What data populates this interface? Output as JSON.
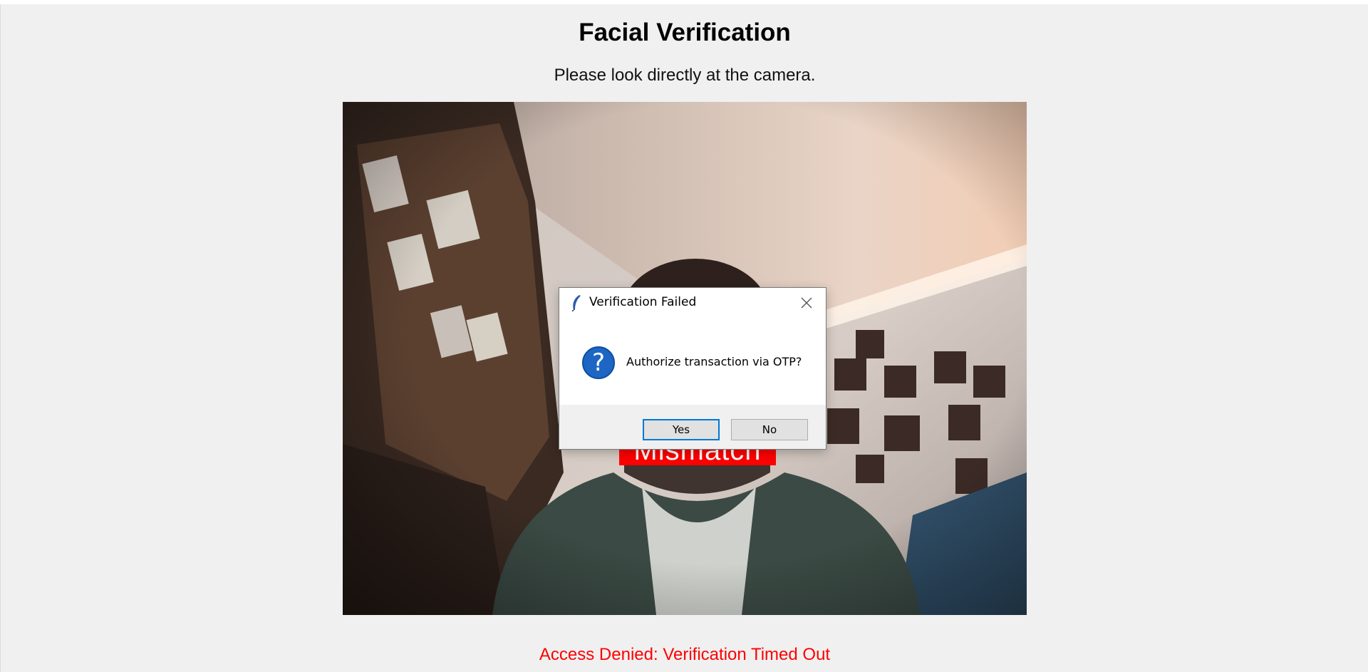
{
  "page": {
    "title": "Facial Verification",
    "instruction": "Please look directly at the camera.",
    "status": "Access Denied: Verification Timed Out"
  },
  "camera": {
    "face_label": "Mismatch",
    "face_label_color": "#ff0000"
  },
  "dialog": {
    "title": "Verification Failed",
    "message": "Authorize transaction via OTP?",
    "icon": "question-icon",
    "yes_label": "Yes",
    "no_label": "No"
  },
  "colors": {
    "status_text": "#ff0000",
    "question_icon": "#1d66c4",
    "default_button_border": "#0078d7"
  }
}
